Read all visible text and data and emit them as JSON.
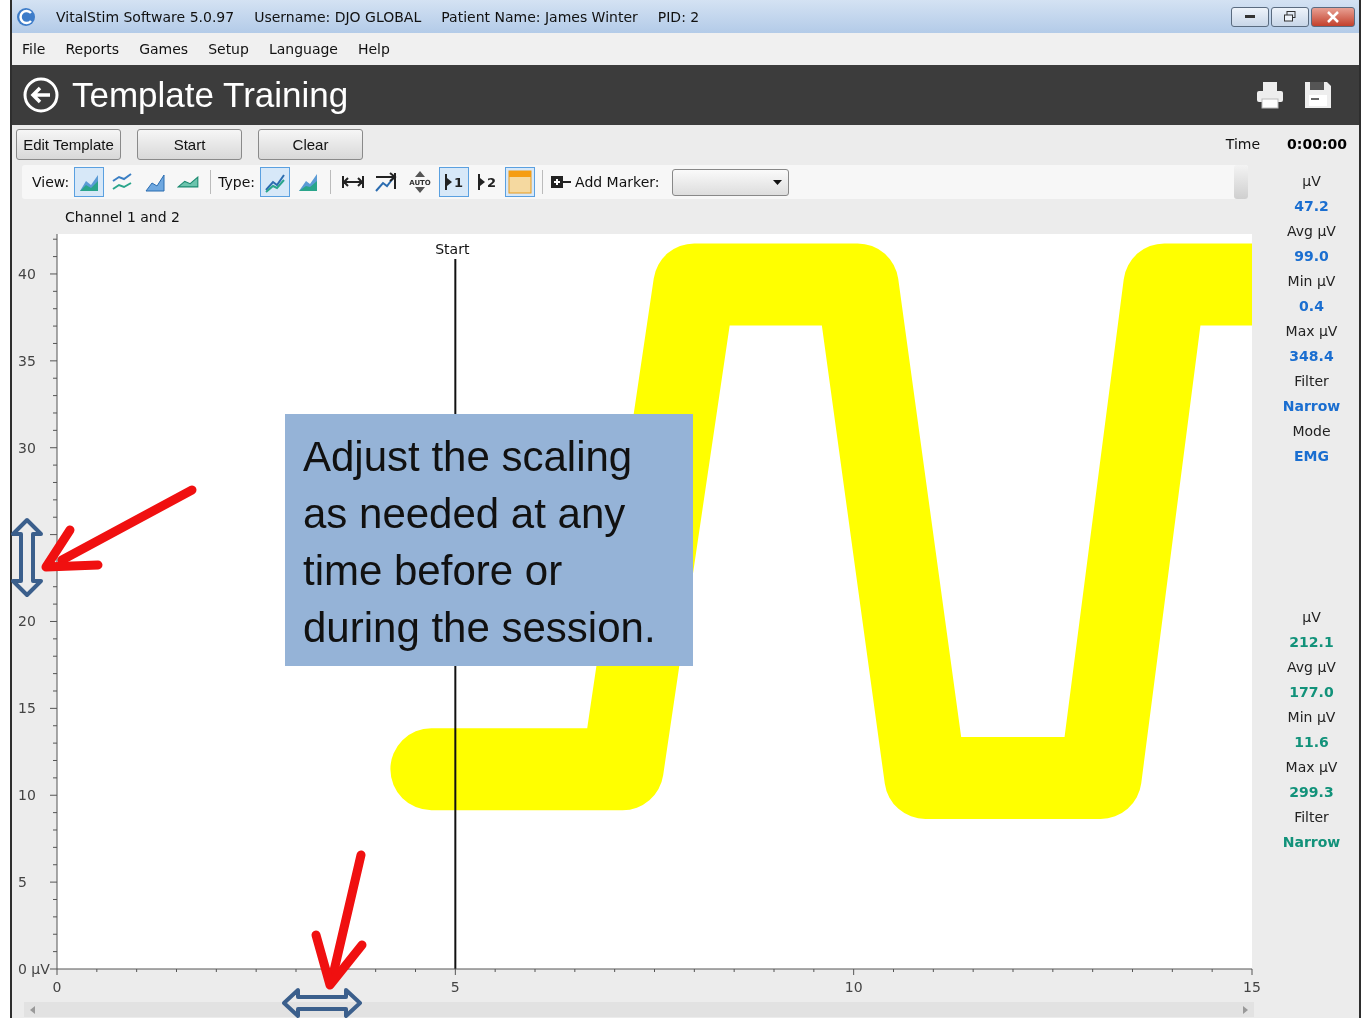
{
  "window": {
    "title": "VitalStim Software 5.0.97",
    "username": "Username: DJO GLOBAL",
    "patient": "Patient Name: James Winter",
    "pid": "PID: 2"
  },
  "menu": [
    "File",
    "Reports",
    "Games",
    "Setup",
    "Language",
    "Help"
  ],
  "header": {
    "title": "Template Training"
  },
  "buttons": [
    "Edit Template",
    "Start",
    "Clear"
  ],
  "time": {
    "label": "Time",
    "value": "0:00:00"
  },
  "toolbar": {
    "view_label": "View:",
    "view_buttons": [
      {
        "selected": true
      },
      {
        "selected": false
      },
      {
        "selected": false
      },
      {
        "selected": false
      }
    ],
    "type_label": "Type:",
    "type_buttons": [
      {
        "selected": true
      },
      {
        "selected": false
      }
    ],
    "tool_buttons": [
      {
        "selected": false
      },
      {
        "selected": false
      },
      {
        "icon_text": "AUTO",
        "selected": false
      },
      {
        "text": "1",
        "selected": true
      },
      {
        "text": "2",
        "selected": false
      },
      {
        "selected": true
      }
    ],
    "add_marker_label": "Add Marker:"
  },
  "channel_label": "Channel 1 and 2",
  "chart": {
    "chart_data": {
      "type": "line",
      "xlim": [
        0,
        15
      ],
      "ylim": [
        0,
        42.3
      ],
      "xticks": [
        0,
        5,
        10,
        15
      ],
      "yticks": [
        {
          "value": 0,
          "label": "0 µV"
        },
        5,
        10,
        15,
        20,
        30,
        35,
        40
      ],
      "x": [
        4.7,
        7.1,
        8.0,
        10.05,
        10.9,
        13.1,
        13.9,
        15
      ],
      "series": [
        {
          "color": "#ffff00",
          "values": [
            11.5,
            11.5,
            39.4,
            39.4,
            11.0,
            11.0,
            39.4,
            39.4
          ]
        }
      ],
      "annotations": [
        "Start"
      ]
    }
  },
  "callout": "Adjust the scaling as needed at any time before or during the session.",
  "channel_stats": [
    {
      "color": "#1a6ed0",
      "items": [
        {
          "label": "µV",
          "value": "47.2"
        },
        {
          "label": "Avg µV",
          "value": "99.0"
        },
        {
          "label": "Min µV",
          "value": "0.4"
        },
        {
          "label": "Max µV",
          "value": "348.4"
        },
        {
          "label": "Filter",
          "value": "Narrow"
        },
        {
          "label": "Mode",
          "value": "EMG"
        }
      ]
    },
    {
      "color": "#12927a",
      "items": [
        {
          "label": "µV",
          "value": "212.1"
        },
        {
          "label": "Avg µV",
          "value": "177.0"
        },
        {
          "label": "Min µV",
          "value": "11.6"
        },
        {
          "label": "Max µV",
          "value": "299.3"
        },
        {
          "label": "Filter",
          "value": "Narrow"
        }
      ]
    }
  ]
}
